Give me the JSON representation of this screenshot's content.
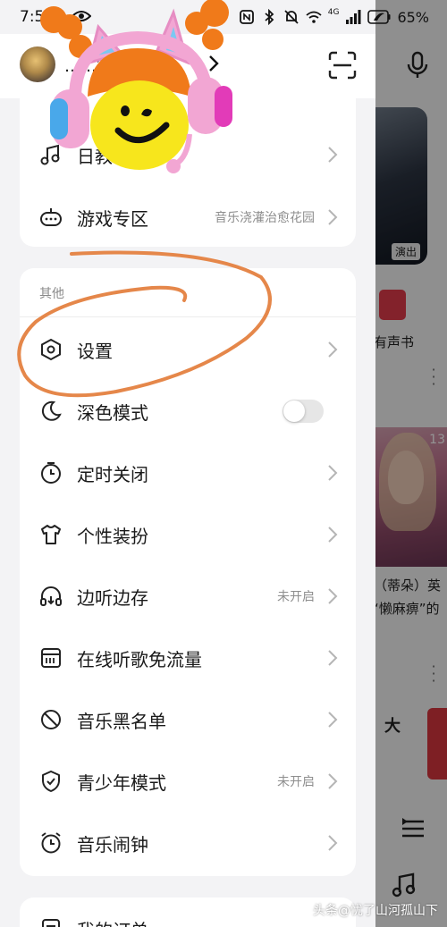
{
  "status_bar": {
    "time": "7:5",
    "battery": "65%",
    "network": "4G"
  },
  "profile": {
    "name": "……签"
  },
  "menu_top": {
    "partial_item_label": "日教",
    "game_zone": {
      "label": "游戏专区",
      "trailing": "音乐浇灌治愈花园"
    }
  },
  "section_other": {
    "title": "其他",
    "items": [
      {
        "label": "设置",
        "trailing": ""
      },
      {
        "label": "深色模式",
        "trailing": "",
        "toggle_on": false
      },
      {
        "label": "定时关闭",
        "trailing": ""
      },
      {
        "label": "个性装扮",
        "trailing": ""
      },
      {
        "label": "边听边存",
        "trailing": "未开启"
      },
      {
        "label": "在线听歌免流量",
        "trailing": ""
      },
      {
        "label": "音乐黑名单",
        "trailing": ""
      },
      {
        "label": "青少年模式",
        "trailing": "未开启"
      },
      {
        "label": "音乐闹钟",
        "trailing": ""
      }
    ]
  },
  "menu_bottom": {
    "partial_item_label": "我的订单"
  },
  "background_app": {
    "badge": "演出",
    "audiobook_label": "有声书",
    "song_line1": "（蒂朵）英",
    "song_line2": "“懒麻痹”的",
    "number_fragment": "13",
    "big_char": "大"
  },
  "watermark": "头条@忧了山河孤山下",
  "colors": {
    "annotation_stroke": "#e5874a",
    "sticker_orange": "#f07a1a",
    "sticker_face": "#f7e61c",
    "sticker_pink": "#f2a6d3"
  }
}
